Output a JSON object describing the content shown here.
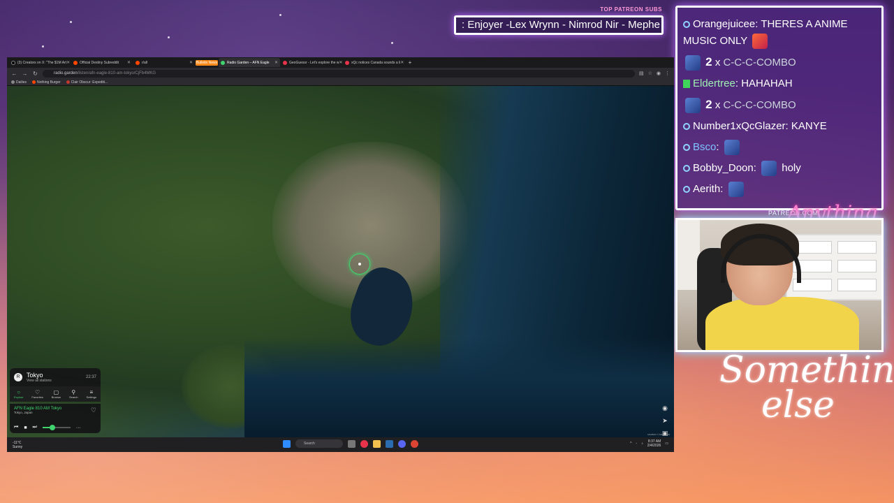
{
  "overlay": {
    "subs_label": "TOP PATREON SUBS",
    "subs_ticker": ": Enjoyer -Lex Wrynn - Nimrod Nir - Mephe",
    "patreon_label": "PATREON.COM/",
    "patreon_script": "Anything Else",
    "signature_line1": "Something",
    "signature_line2": "else"
  },
  "chat": {
    "messages": [
      {
        "user": "Orangejuicee",
        "text": "THERES A ANIME MUSIC ONLY"
      },
      {
        "count": "2",
        "x": "x",
        "combo": "C-C-C-COMBO"
      },
      {
        "user": "Eldertree",
        "text": "HAHAHAH"
      },
      {
        "count": "2",
        "x": "x",
        "combo": "C-C-C-COMBO"
      },
      {
        "user": "Number1xQcGlazer",
        "text": "KANYE"
      },
      {
        "user": "Bsco",
        "text": ""
      },
      {
        "user": "Bobby_Doon",
        "text": "holy"
      },
      {
        "user": "Aerith",
        "text": ""
      }
    ]
  },
  "browser": {
    "tabs": [
      {
        "label": "(3) Creators on X: \"The $1M Art"
      },
      {
        "label": "Official Destiny Subreddit"
      },
      {
        "label": "r/all"
      },
      {
        "label": "Bulletin News"
      },
      {
        "label": "Radio Garden – AFN Eagle"
      },
      {
        "label": "GeoGuessr - Let's explore the w"
      },
      {
        "label": "xQc notices Canada sounds a li"
      }
    ],
    "new_tab": "+",
    "url_host": "radio.garden",
    "url_path": "/listen/afn-eagle-810-am-tokyo/CjFb4MKG",
    "bookmarks": [
      "Dailies",
      "Nothing Burger",
      "Clair Obscur: Expediti..."
    ]
  },
  "radio_garden": {
    "city": "Tokyo",
    "city_sub": "View all stations",
    "city_avatar": "R",
    "time": "22:37",
    "nav": [
      "Explore",
      "Favorites",
      "Browse",
      "Search",
      "Settings"
    ],
    "station": "AFN Eagle 810 AM Tokyo",
    "location": "Tokyo, Japan",
    "volume": 0.35,
    "attribution": "MAPBOX © MAPTILER"
  },
  "taskbar": {
    "temp": "-11°C",
    "weather": "Sunny",
    "search_placeholder": "Search",
    "time": "8:37 AM",
    "date": "2/4/2026"
  },
  "colors": {
    "accent_green": "#3fd46e",
    "chat_bg": "#502882",
    "glow_cyan": "#70f6ff"
  }
}
